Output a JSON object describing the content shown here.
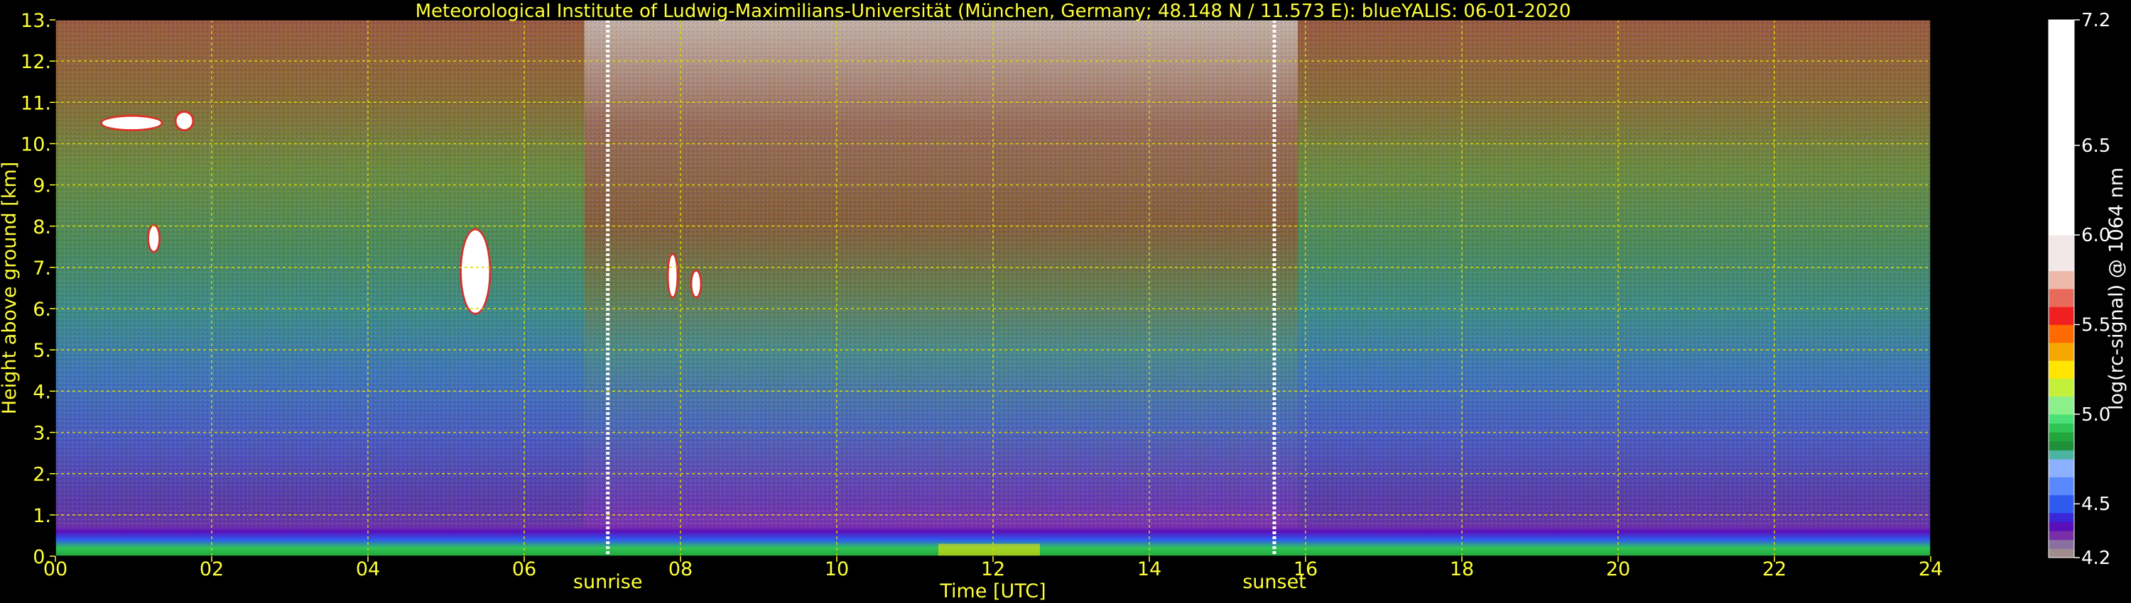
{
  "chart_data": {
    "type": "heatmap",
    "title": "Meteorological Institute of Ludwig-Maximilians-Universität (München, Germany; 48.148 N / 11.573 E):    blueYALIS: 06-01-2020",
    "xlabel": "Time [UTC]",
    "ylabel": "Height above ground [km]",
    "xlim": [
      0,
      24
    ],
    "ylim": [
      0,
      13
    ],
    "x_ticks": [
      0,
      2,
      4,
      6,
      8,
      10,
      12,
      14,
      16,
      18,
      20,
      22,
      24
    ],
    "x_tick_labels": [
      "00",
      "02",
      "04",
      "06",
      "08",
      "10",
      "12",
      "14",
      "16",
      "18",
      "20",
      "22",
      "24"
    ],
    "y_ticks": [
      0,
      1,
      2,
      3,
      4,
      5,
      6,
      7,
      8,
      9,
      10,
      11,
      12,
      13
    ],
    "y_tick_labels": [
      "0.",
      "1.",
      "2.",
      "3.",
      "4.",
      "5.",
      "6.",
      "7.",
      "8.",
      "9.",
      "10.",
      "11.",
      "12.",
      "13."
    ],
    "grid": true,
    "annotations": [
      {
        "label": "sunrise",
        "x": 7.07
      },
      {
        "label": "sunset",
        "x": 15.6
      }
    ],
    "colorbar": {
      "label": "log(rc-signal) @ 1064 nm",
      "range": [
        4.2,
        7.2
      ],
      "tick_values": [
        4.2,
        4.5,
        5.0,
        5.5,
        6.0,
        6.5,
        7.2
      ],
      "tick_labels": [
        "4.2",
        "4.5",
        "5.0",
        "5.5",
        "6.0",
        "6.5",
        "7.2"
      ],
      "bands": [
        {
          "from": 4.2,
          "to": 4.25,
          "color": "#a08c8c"
        },
        {
          "from": 4.25,
          "to": 4.3,
          "color": "#8a6fa0"
        },
        {
          "from": 4.3,
          "to": 4.35,
          "color": "#7a2fa8"
        },
        {
          "from": 4.35,
          "to": 4.4,
          "color": "#5a10b8"
        },
        {
          "from": 4.4,
          "to": 4.45,
          "color": "#3a28d8"
        },
        {
          "from": 4.45,
          "to": 4.55,
          "color": "#2e5af0"
        },
        {
          "from": 4.55,
          "to": 4.65,
          "color": "#5a88ff"
        },
        {
          "from": 4.65,
          "to": 4.75,
          "color": "#8ab0ff"
        },
        {
          "from": 4.75,
          "to": 4.8,
          "color": "#4ab4a0"
        },
        {
          "from": 4.8,
          "to": 4.85,
          "color": "#1f8f3a"
        },
        {
          "from": 4.85,
          "to": 4.9,
          "color": "#22a53c"
        },
        {
          "from": 4.9,
          "to": 4.95,
          "color": "#2fc455"
        },
        {
          "from": 4.95,
          "to": 5.0,
          "color": "#4cdf78"
        },
        {
          "from": 5.0,
          "to": 5.1,
          "color": "#8bef8b"
        },
        {
          "from": 5.1,
          "to": 5.2,
          "color": "#c3f03a"
        },
        {
          "from": 5.2,
          "to": 5.3,
          "color": "#ffe500"
        },
        {
          "from": 5.3,
          "to": 5.4,
          "color": "#f5a600"
        },
        {
          "from": 5.4,
          "to": 5.5,
          "color": "#ff6a00"
        },
        {
          "from": 5.5,
          "to": 5.6,
          "color": "#f02020"
        },
        {
          "from": 5.6,
          "to": 5.7,
          "color": "#e86a5a"
        },
        {
          "from": 5.7,
          "to": 5.8,
          "color": "#ecb8a8"
        },
        {
          "from": 5.8,
          "to": 6.0,
          "color": "#f2e8e8"
        },
        {
          "from": 6.0,
          "to": 7.2,
          "color": "#ffffff"
        }
      ]
    },
    "cloud_features": [
      {
        "x": [
          0.6,
          1.35
        ],
        "y": [
          10.35,
          10.65
        ]
      },
      {
        "x": [
          1.55,
          1.75
        ],
        "y": [
          10.35,
          10.75
        ]
      },
      {
        "x": [
          1.2,
          1.32
        ],
        "y": [
          7.4,
          8.0
        ]
      },
      {
        "x": [
          5.2,
          5.55
        ],
        "y": [
          5.9,
          7.9
        ]
      },
      {
        "x": [
          7.85,
          7.95
        ],
        "y": [
          6.3,
          7.3
        ]
      },
      {
        "x": [
          8.15,
          8.25
        ],
        "y": [
          6.3,
          6.9
        ]
      }
    ],
    "colors": {
      "text": "#ffff3a",
      "grid": "#d8d800",
      "background": "#000000",
      "sun_line": "#ffffff"
    }
  }
}
